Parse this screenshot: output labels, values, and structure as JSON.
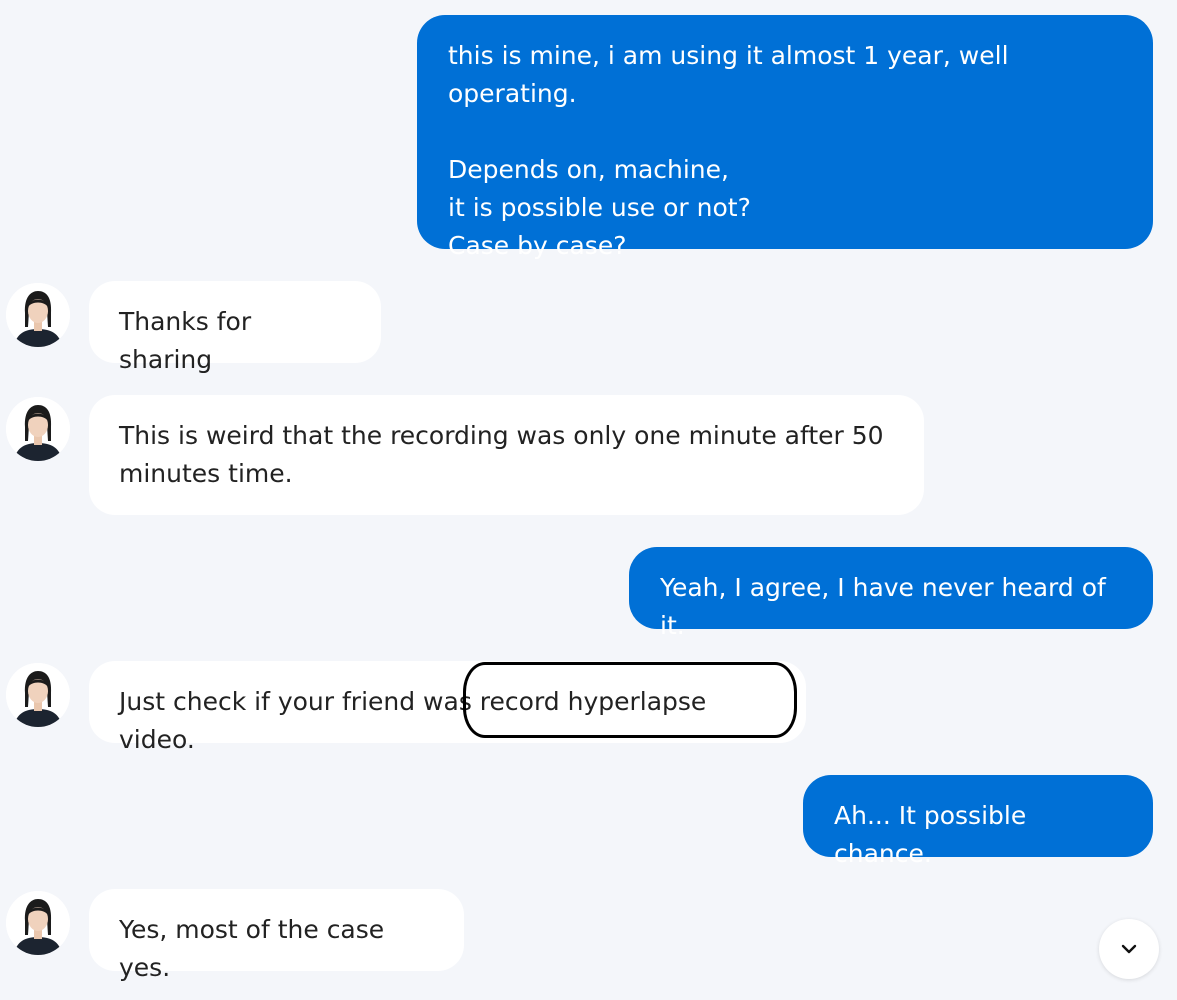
{
  "conversation": {
    "messages": [
      {
        "id": "m1",
        "sender": "user",
        "text": "this is mine, i am using it almost 1 year, well operating.\n\nDepends on, machine,\nit is possible use or not?\nCase by case?"
      },
      {
        "id": "m2",
        "sender": "agent",
        "text": "Thanks for sharing"
      },
      {
        "id": "m3",
        "sender": "agent",
        "text": "This is weird that the recording was only one minute after 50\nminutes time."
      },
      {
        "id": "m4",
        "sender": "user",
        "text": "Yeah, I agree, I have never heard of it."
      },
      {
        "id": "m5",
        "sender": "agent",
        "text": "Just check if your friend was record hyperlapse video."
      },
      {
        "id": "m6",
        "sender": "user",
        "text": "Ah... It possible chance."
      },
      {
        "id": "m7",
        "sender": "agent",
        "text": "Yes, most of the case yes."
      }
    ]
  },
  "controls": {
    "scroll_down_icon": "chevron-down-icon"
  },
  "colors": {
    "page_background": "#f4f6fa",
    "user_bubble": "#0070d6",
    "agent_bubble": "#ffffff",
    "agent_text": "#222222",
    "annotation_ring": "#000000"
  }
}
